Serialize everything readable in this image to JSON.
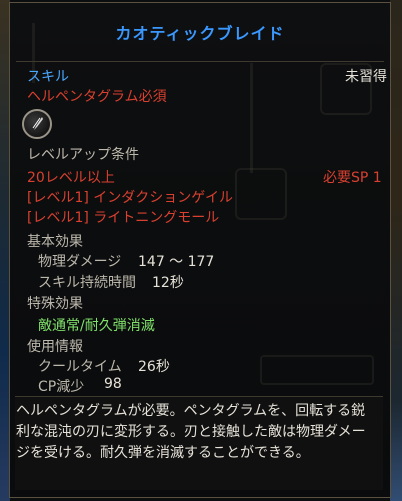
{
  "tooltip": {
    "title": "カオティックブレイド",
    "category_label": "スキル",
    "status": "未習得",
    "requirement": "ヘルペンタグラム必須",
    "icon": "chaotic-blade-skill-icon",
    "levelup": {
      "heading": "レベルアップ条件",
      "level_req": "20レベル以上",
      "sp_label": "必要SP 1",
      "prereq1": "[レベル1] インダクションゲイル",
      "prereq2": "[レベル1] ライトニングモール"
    },
    "basic": {
      "heading": "基本効果",
      "dmg_label": "物理ダメージ",
      "dmg_value": "147 ～ 177",
      "dur_label": "スキル持続時間",
      "dur_value": "12秒"
    },
    "special": {
      "heading": "特殊効果",
      "effect": "敵通常/耐久弾消滅"
    },
    "usage": {
      "heading": "使用情報",
      "cd_label": "クールタイム",
      "cd_value": "26秒",
      "cp_label": "CP減少",
      "cp_value": "98"
    },
    "description": "ヘルペンタグラムが必要。ペンタグラムを、回転する鋭利な混沌の刃に変形する。刃と接触した敵は物理ダメージを受ける。耐久弾を消滅することができる。"
  },
  "colors": {
    "title": "#3a98ff",
    "red": "#d9402f",
    "green": "#7fe06a",
    "border": "#5a5140"
  }
}
